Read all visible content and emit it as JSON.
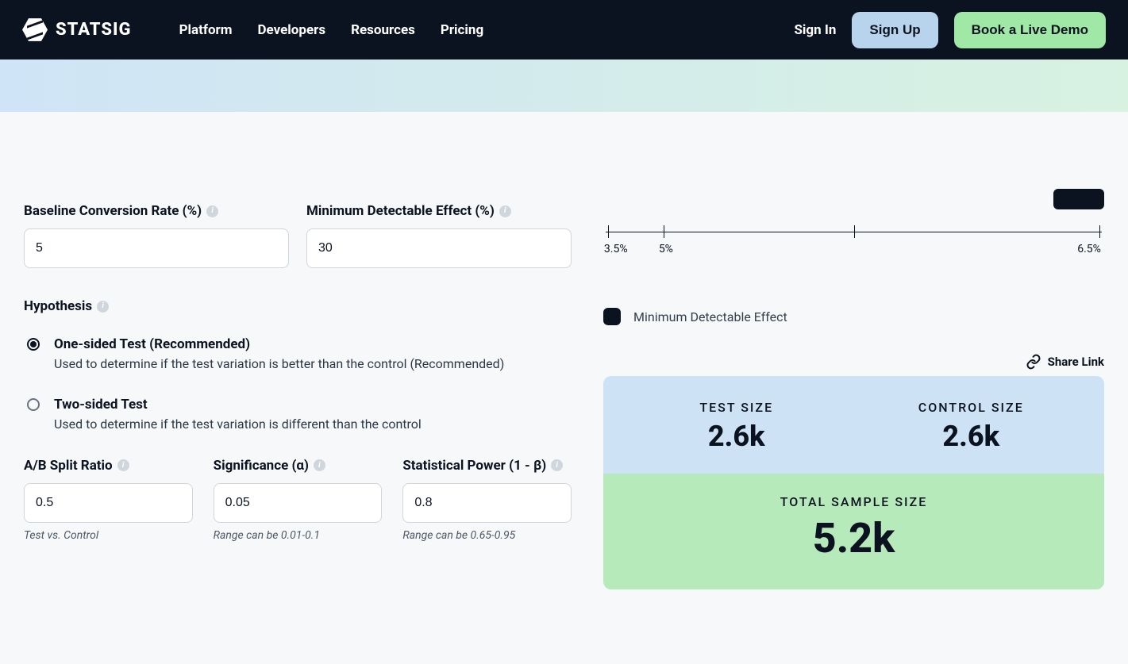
{
  "header": {
    "logo_text": "STATSIG",
    "nav": [
      "Platform",
      "Developers",
      "Resources",
      "Pricing"
    ],
    "sign_in": "Sign In",
    "sign_up": "Sign Up",
    "book_demo": "Book a Live Demo"
  },
  "form": {
    "baseline": {
      "label": "Baseline Conversion Rate (%)",
      "value": "5"
    },
    "mde": {
      "label": "Minimum Detectable Effect (%)",
      "value": "30"
    },
    "hypothesis": {
      "title": "Hypothesis",
      "one_sided": {
        "label": "One-sided Test (Recommended)",
        "desc": "Used to determine if the test variation is better than the control (Recommended)",
        "checked": true
      },
      "two_sided": {
        "label": "Two-sided Test",
        "desc": "Used to determine if the test variation is different than the control",
        "checked": false
      }
    },
    "split": {
      "label": "A/B Split Ratio",
      "value": "0.5",
      "helper": "Test vs. Control"
    },
    "significance": {
      "label": "Significance (α)",
      "value": "0.05",
      "helper": "Range can be 0.01-0.1"
    },
    "power": {
      "label": "Statistical Power (1 - β)",
      "value": "0.8",
      "helper": "Range can be 0.65-0.95"
    }
  },
  "chart_data": {
    "type": "line",
    "x": [
      3.5,
      5,
      6.5
    ],
    "xlabel": "",
    "ylabel": "",
    "tick_labels": [
      "3.5%",
      "5%",
      "6.5%"
    ],
    "legend": "Minimum Detectable Effect"
  },
  "share": {
    "label": "Share Link"
  },
  "results": {
    "test_size_label": "TEST SIZE",
    "test_size_value": "2.6k",
    "control_size_label": "CONTROL SIZE",
    "control_size_value": "2.6k",
    "total_label": "TOTAL SAMPLE SIZE",
    "total_value": "5.2k"
  }
}
